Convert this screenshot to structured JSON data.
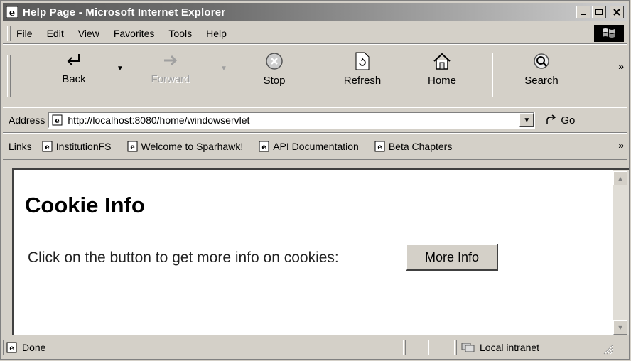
{
  "window": {
    "title": "Help Page - Microsoft Internet Explorer"
  },
  "menu": [
    "File",
    "Edit",
    "View",
    "Favorites",
    "Tools",
    "Help"
  ],
  "menu_mnemonic_index": [
    0,
    0,
    0,
    2,
    0,
    0
  ],
  "toolbar": {
    "back": "Back",
    "forward": "Forward",
    "stop": "Stop",
    "refresh": "Refresh",
    "home": "Home",
    "search": "Search"
  },
  "address": {
    "label": "Address",
    "value": "http://localhost:8080/home/windowservlet",
    "go": "Go"
  },
  "links": {
    "label": "Links",
    "items": [
      "InstitutionFS",
      "Welcome to Sparhawk!",
      "API Documentation",
      "Beta Chapters"
    ]
  },
  "page": {
    "heading": "Cookie Info",
    "text": "Click on the button to get more info on cookies:",
    "button": "More Info"
  },
  "status": {
    "text": "Done",
    "zone": "Local intranet"
  },
  "icons": [
    "ie-icon",
    "minimize-icon",
    "maximize-icon",
    "close-icon",
    "windows-logo-icon",
    "back-arrow-icon",
    "forward-arrow-icon",
    "stop-icon",
    "refresh-icon",
    "home-icon",
    "search-icon",
    "page-icon",
    "go-arrow-icon",
    "intranet-icon"
  ]
}
